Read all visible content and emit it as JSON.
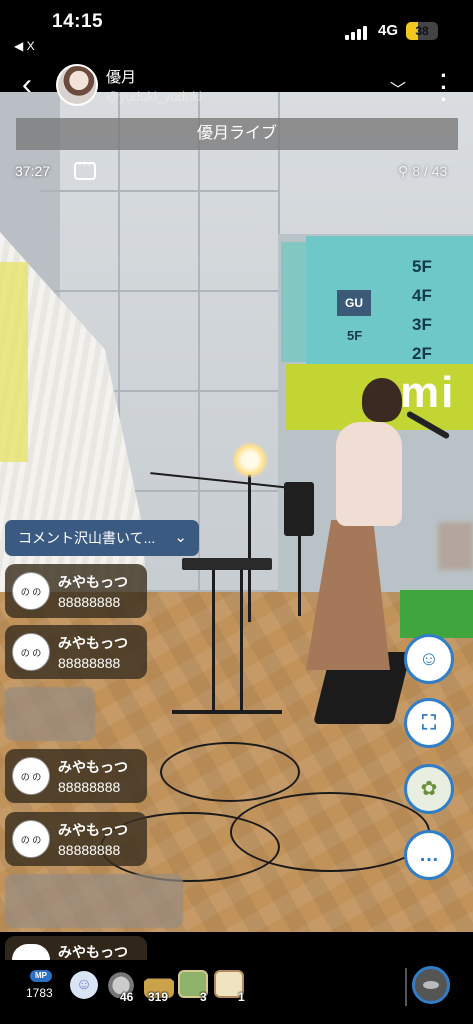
{
  "status_bar": {
    "time": "14:15",
    "back_app": "◀ X",
    "network": "4G",
    "battery": "38"
  },
  "header": {
    "host_name": "優月",
    "host_handle": "@yuduki_yuduki",
    "back_icon": "chevron-left-icon",
    "menu_icon": "chevron-down-icon",
    "more_icon": "vertical-dots-icon"
  },
  "live": {
    "title": "優月ライブ",
    "duration": "37:27",
    "viewers": "8 / 43"
  },
  "scene_text": {
    "gu": "GU",
    "gu_floor": "5F",
    "floors": [
      "5F",
      "4F",
      "3F",
      "2F"
    ],
    "mini": "mi"
  },
  "comments": {
    "toggle_label": "コメント沢山書いて...",
    "items": [
      {
        "name": "みやもっつ",
        "text": "88888888"
      },
      {
        "name": "みやもっつ",
        "text": "88888888"
      },
      {
        "name": "みやもっつ",
        "text": "88888888"
      },
      {
        "name": "みやもっつ",
        "text": "88888888"
      }
    ],
    "peek_name": "みやもっつ",
    "avatar_label": "の の"
  },
  "actions": [
    {
      "icon": "chat-bubble-icon"
    },
    {
      "icon": "screenshot-icon"
    },
    {
      "icon": "gift-bag-icon"
    },
    {
      "icon": "comment-dots-icon"
    }
  ],
  "bottom_bar": {
    "mp_badge": "MP",
    "mp_count": "1783",
    "gifts": [
      {
        "icon": "coin-icon",
        "count": "46"
      },
      {
        "icon": "house-icon",
        "count": "319"
      },
      {
        "icon": "card-icon",
        "count": "3"
      },
      {
        "icon": "scroll-icon",
        "count": "1"
      }
    ]
  },
  "colors": {
    "accent_blue": "#2f7ec7",
    "comment_toggle": "#3a5a82",
    "battery": "#f2c81f",
    "store_green": "#c3d533"
  }
}
